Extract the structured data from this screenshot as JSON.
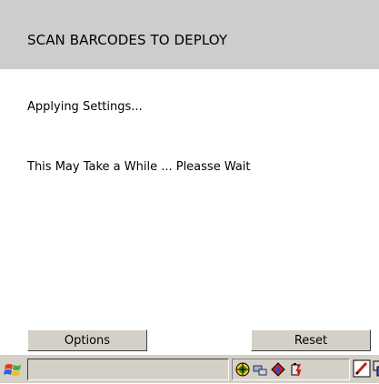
{
  "header": {
    "title": "SCAN BARCODES TO DEPLOY"
  },
  "main": {
    "status": "Applying Settings...",
    "message": "This May Take a While ... Pleasse Wait"
  },
  "buttons": {
    "options_label": "Options",
    "reset_label": "Reset"
  },
  "taskbar": {
    "start_icon": "windows-flag-icon",
    "sip_value": "",
    "tray_icons": [
      "network-globe-icon",
      "connection-icon",
      "battery-charge-icon",
      "power-icon"
    ],
    "right_icons": [
      "sip-pen-icon",
      "windows-switcher-icon"
    ]
  },
  "colors": {
    "header_bg": "#cdcdcd",
    "button_face": "#d4d0c8"
  }
}
